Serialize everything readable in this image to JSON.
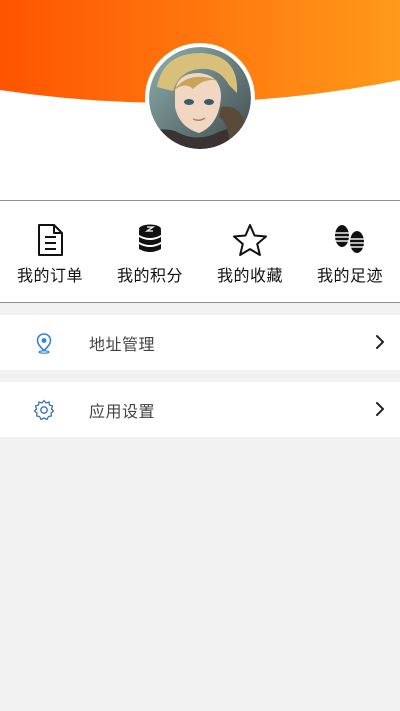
{
  "header": {
    "avatar_icon": "user-avatar",
    "gradient_start": "#ff5a00",
    "gradient_end": "#ff9a1a"
  },
  "quick_nav": [
    {
      "label": "我的订单",
      "icon": "document-icon"
    },
    {
      "label": "我的积分",
      "icon": "coin-stack-icon"
    },
    {
      "label": "我的收藏",
      "icon": "star-icon"
    },
    {
      "label": "我的足迹",
      "icon": "footprints-icon"
    }
  ],
  "menu": [
    {
      "label": "地址管理",
      "icon": "location-pin-icon"
    },
    {
      "label": "应用设置",
      "icon": "gear-icon"
    }
  ],
  "colors": {
    "accent_icon": "#2f86d6",
    "page_bg": "#f2f2f2"
  }
}
